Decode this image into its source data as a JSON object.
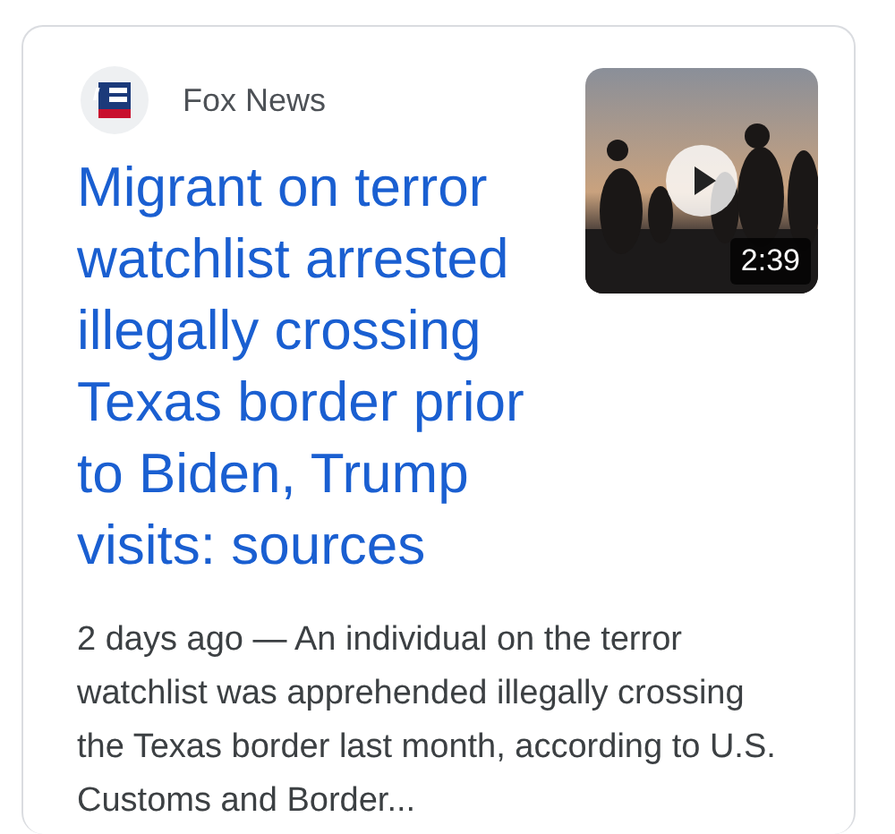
{
  "source": {
    "name": "Fox News"
  },
  "headline": "Migrant on terror watchlist arrested illegally crossing Texas border prior to Biden, Trump visits: sources",
  "video": {
    "kind": "picture",
    "duration": "2:39"
  },
  "snippet": "2 days ago — An individual on the terror watchlist was apprehended illegally crossing the Texas border last month, according to U.S. Customs and Border..."
}
